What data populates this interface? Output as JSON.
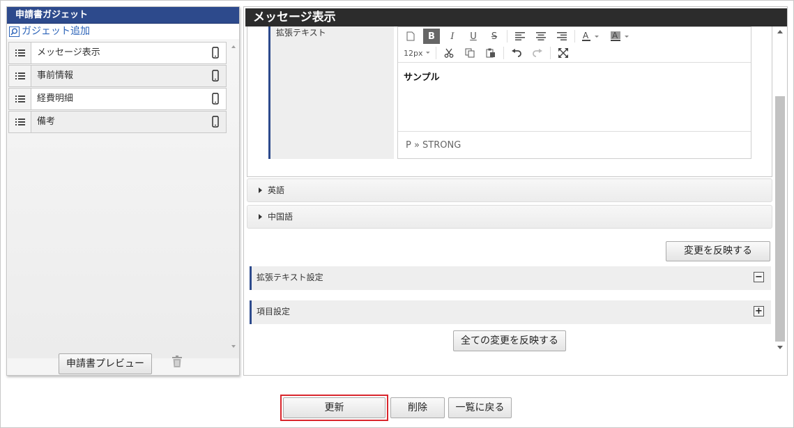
{
  "left_panel": {
    "title": "申請書ガジェット",
    "add_link": "ガジェット追加",
    "items": [
      {
        "label": "メッセージ表示"
      },
      {
        "label": "事前情報"
      },
      {
        "label": "経費明細"
      },
      {
        "label": "備考"
      }
    ],
    "preview_button": "申請書プレビュー"
  },
  "right_panel": {
    "title": "メッセージ表示",
    "field_label": "拡張テキスト",
    "editor": {
      "font_size": "12px",
      "content": "サンプル",
      "status_path": "P » STRONG"
    },
    "accordions": [
      {
        "label": "英語"
      },
      {
        "label": "中国語"
      }
    ],
    "apply_button": "変更を反映する",
    "sections": [
      {
        "label": "拡張テキスト設定",
        "toggle": "−"
      },
      {
        "label": "項目設定",
        "toggle": "+"
      }
    ],
    "apply_all_button": "全ての変更を反映する"
  },
  "footer": {
    "update_button": "更新",
    "delete_button": "削除",
    "back_button": "一覧に戻る"
  },
  "colors": {
    "left_header_bg": "#2d4a8c",
    "right_header_bg": "#2c2c2c",
    "link": "#2a62b8",
    "highlight_border": "#d9262c"
  }
}
